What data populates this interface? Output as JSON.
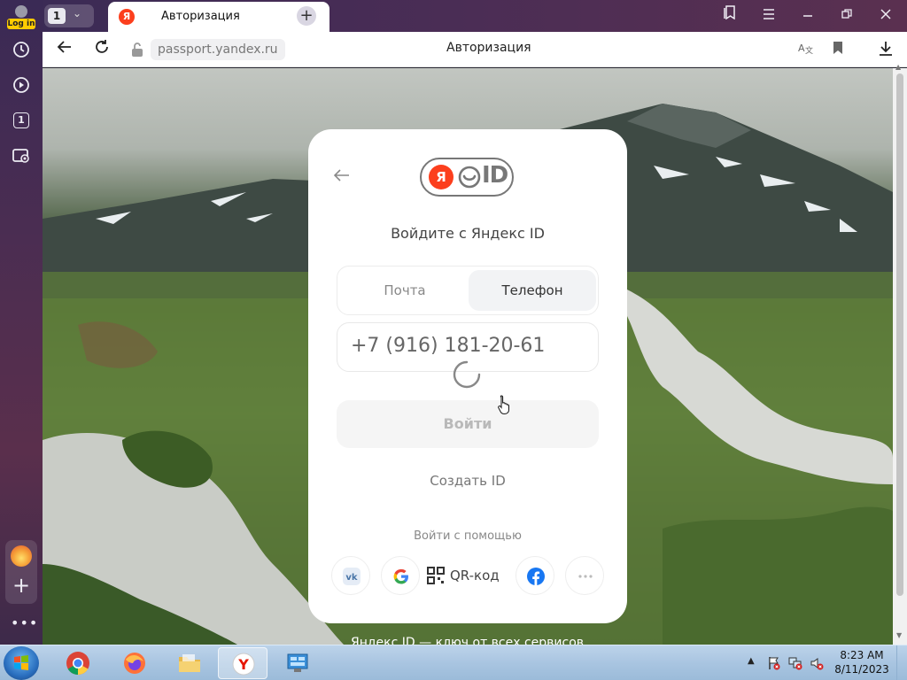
{
  "browser": {
    "login_badge": "Log in",
    "tab_group_count": "1",
    "tab_title": "Авторизация",
    "tab_favicon": "Я",
    "tab_close": "×",
    "new_tab": "+",
    "url": "passport.yandex.ru",
    "page_title": "Авторизация",
    "sidebar_icons": [
      "clock-icon",
      "play-icon",
      "tab-count-icon",
      "screenshot-icon",
      "zen-icon",
      "plus-icon",
      "more-icon"
    ],
    "sidebar_tab_count": "1",
    "window_controls": [
      "bookmarks-collection-icon",
      "menu-icon",
      "minimize-icon",
      "restore-icon",
      "close-icon"
    ]
  },
  "login_card": {
    "logo_ya": "Я",
    "logo_id": "ID",
    "heading": "Войдите с Яндекс ID",
    "tabs": [
      {
        "label": "Почта",
        "selected": false
      },
      {
        "label": "Телефон",
        "selected": true
      }
    ],
    "phone_value": "+7 (916) 181-20-61",
    "submit_label": "Войти",
    "create_id": "Создать ID",
    "alt_login_label": "Войти с помощью",
    "qr_label": "QR-код",
    "social_providers": [
      "vk-icon",
      "google-icon",
      "qr-code-icon",
      "facebook-icon",
      "more-icon"
    ]
  },
  "page_footer": {
    "tagline": "Яндекс ID — ключ от всех сервисов"
  },
  "taskbar": {
    "apps": [
      "chrome-icon",
      "firefox-icon",
      "explorer-icon",
      "yandex-browser-icon",
      "control-panel-icon"
    ],
    "active_app": "yandex-browser-icon",
    "time": "8:23 AM",
    "date": "8/11/2023"
  },
  "colors": {
    "yandex_red": "#fc3f1d",
    "card_bg": "#ffffff",
    "taskbar": "#a9c5e1"
  }
}
